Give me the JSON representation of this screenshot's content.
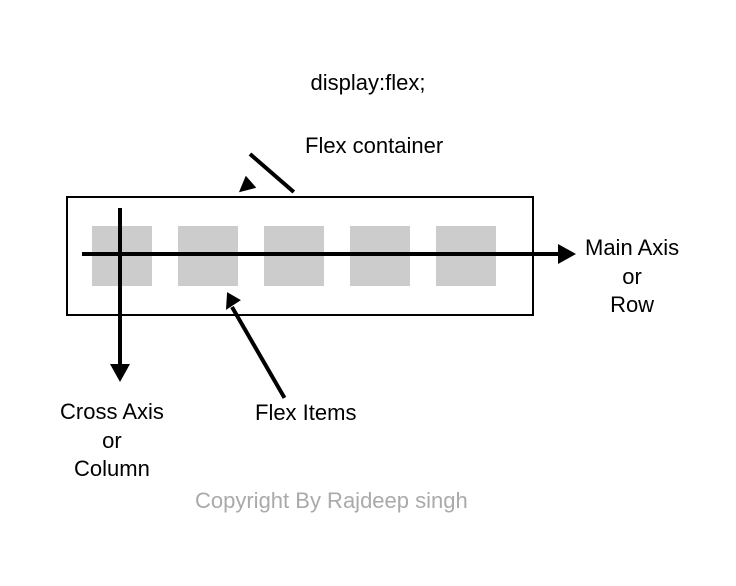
{
  "title": "display:flex;",
  "labels": {
    "flex_container": "Flex container",
    "flex_items": "Flex Items",
    "main_axis": "Main Axis\nor\nRow",
    "cross_axis": "Cross Axis\nor\nColumn",
    "copyright": "Copyright By Rajdeep singh"
  },
  "diagram": {
    "item_count": 5,
    "item_color": "#cccccc",
    "container_border": "#000000"
  }
}
